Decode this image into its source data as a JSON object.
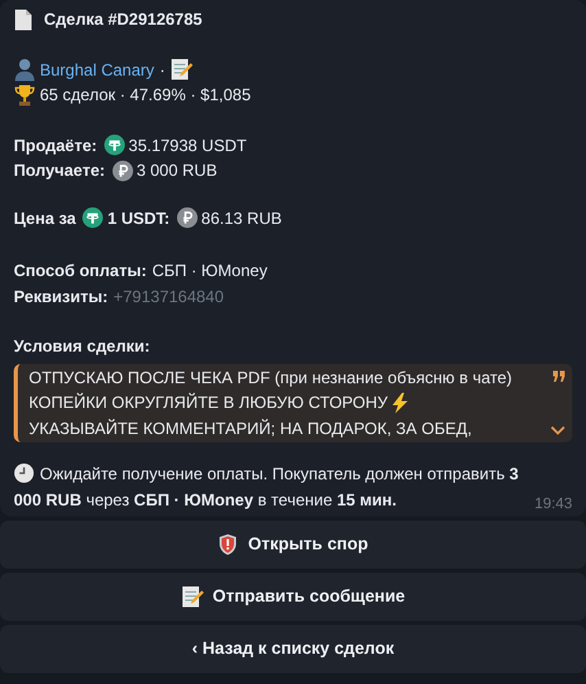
{
  "header": {
    "title": "Сделка #D29126785"
  },
  "seller": {
    "name": "Burghal Canary",
    "separator": "·",
    "stats": "65 сделок · 47.69% · $1,085"
  },
  "amounts": [
    {
      "label": "Продаёте:",
      "kind": "usdt",
      "value": "35.17938 USDT"
    },
    {
      "label": "Получаете:",
      "kind": "rub",
      "value": "3 000 RUB"
    }
  ],
  "price": {
    "label": "Цена за",
    "amount": "1 USDT:",
    "value": "86.13 RUB"
  },
  "payment": {
    "label": "Способ оплаты:",
    "value": "СБП · ЮMoney"
  },
  "requisites": {
    "label": "Реквизиты:",
    "value": "+79137164840"
  },
  "terms": {
    "label": "Условия сделки:",
    "expanded": false,
    "lines": [
      {
        "text": "ОТПУСКАЮ ПОСЛЕ ЧЕКА PDF (при незнание объясню в чате)",
        "kind": "plain"
      },
      {
        "text": "КОПЕЙКИ ОКРУГЛЯЙТЕ В ЛЮБУЮ СТОРОНУ",
        "kind": "lightning"
      },
      {
        "text": "УКАЗЫВАЙТЕ КОММЕНТАРИЙ; НА ПОДАРОК, ЗА ОБЕД,",
        "kind": "plain"
      }
    ]
  },
  "status": {
    "text": "Ожидайте получение оплаты. Покупатель должен отправить **3 000 RUB** через **СБП · ЮMoney** в течение **15 мин.**",
    "time": "19:43"
  },
  "buttons": [
    {
      "label": "Открыть спор",
      "kind": "shield"
    },
    {
      "label": "Отправить сообщение",
      "kind": "memo"
    },
    {
      "label": "‹ Назад к списку сделок",
      "kind": "plain"
    }
  ]
}
